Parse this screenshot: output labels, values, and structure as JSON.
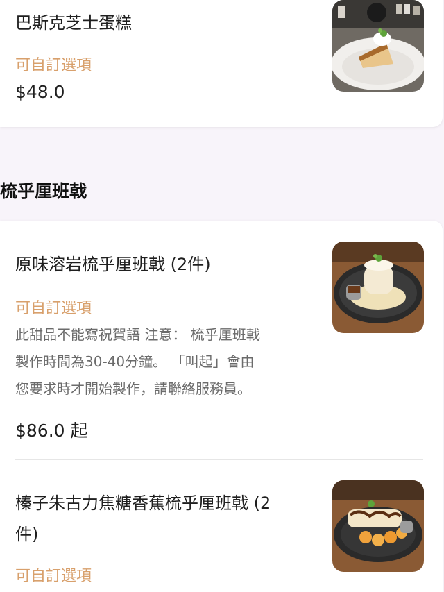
{
  "menu": {
    "items": [
      {
        "name": "巴斯克芝士蛋糕",
        "custom_label": "可自訂選項",
        "price": "$48.0"
      },
      {
        "name": "原味溶岩梳乎厘班戟 (2件)",
        "custom_label": "可自訂選項",
        "description_lines": [
          "此甜品不能寫祝賀語 注意： 梳乎厘班戟",
          "製作時間為30-40分鐘。 「叫起」會由",
          "您要求時才開始製作，請聯絡服務員。"
        ],
        "price": "$86.0 起"
      },
      {
        "name_lines": [
          "榛子朱古力焦糖香蕉梳乎厘班戟 (2",
          "件)"
        ],
        "custom_label": "可自訂選項"
      }
    ],
    "section_title": "梳乎厘班戟"
  },
  "colors": {
    "accent": "#d8a06c",
    "background": "#f8f4fa",
    "card": "#ffffff"
  }
}
